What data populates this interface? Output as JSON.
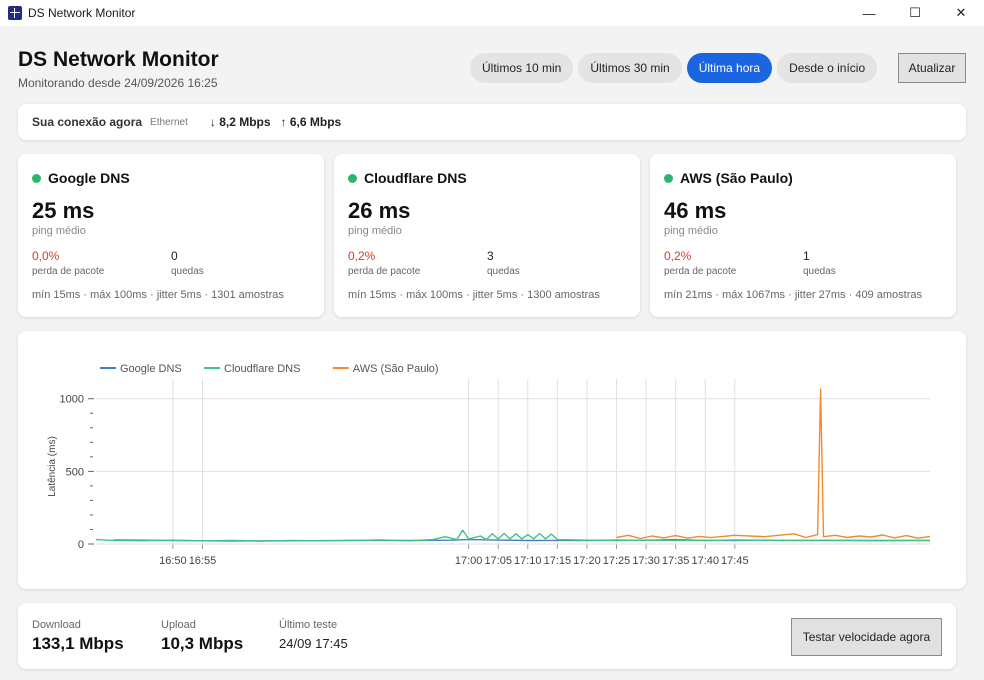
{
  "window": {
    "title": "DS Network Monitor",
    "controls": [
      "—",
      "☐",
      "✕"
    ]
  },
  "header": {
    "title": "DS Network Monitor",
    "subtitle": "Monitorando desde 24/09/2026 16:25",
    "ranges": [
      {
        "label": "Últimos 10 min",
        "active": false
      },
      {
        "label": "Últimos 30 min",
        "active": false
      },
      {
        "label": "Última hora",
        "active": true
      },
      {
        "label": "Desde o início",
        "active": false
      }
    ],
    "refresh_label": "Atualizar"
  },
  "connection": {
    "label": "Sua conexão agora",
    "type": "Ethernet",
    "download": "↓ 8,2 Mbps",
    "upload": "↑ 6,6 Mbps"
  },
  "servers": [
    {
      "name": "Google DNS",
      "ping": "25 ms",
      "ping_label": "ping médio",
      "loss": "0,0%",
      "loss_label": "perda de pacote",
      "drops": "0",
      "drops_label": "quedas",
      "summary": "mín 15ms · máx 100ms · jitter 5ms · 1301 amostras"
    },
    {
      "name": "Cloudflare DNS",
      "ping": "26 ms",
      "ping_label": "ping médio",
      "loss": "0,2%",
      "loss_label": "perda de pacote",
      "drops": "3",
      "drops_label": "quedas",
      "summary": "mín 15ms · máx 100ms · jitter 5ms · 1300 amostras"
    },
    {
      "name": "AWS (São Paulo)",
      "ping": "46 ms",
      "ping_label": "ping médio",
      "loss": "0,2%",
      "loss_label": "perda de pacote",
      "drops": "1",
      "drops_label": "quedas",
      "summary": "mín 21ms · máx 1067ms · jitter 27ms · 409 amostras"
    }
  ],
  "colors": {
    "accent": "#1b66e0",
    "status_ok": "#2db56b",
    "loss_red": "#d23c2e",
    "google": "#4a7fc1",
    "cloudflare": "#3cc48a",
    "aws": "#f08a2c"
  },
  "chart_data": {
    "type": "line",
    "ylabel": "Latência (ms)",
    "xlabel": "",
    "ylim": [
      0,
      1067
    ],
    "yticks": [
      "0",
      "500",
      "1000"
    ],
    "x_domain_min": [
      16.37,
      17.78
    ],
    "xticks": [
      "16:50",
      "16:55",
      "17:00",
      "17:05",
      "17:10",
      "17:15",
      "17:20",
      "17:25",
      "17:30",
      "17:35",
      "17:40",
      "17:45"
    ],
    "legend_position": "top-left",
    "grid": true,
    "series": [
      {
        "name": "Google DNS",
        "color": "#4a7fc1",
        "points": [
          [
            16.4,
            28
          ],
          [
            16.5,
            24
          ],
          [
            16.6,
            20
          ],
          [
            16.7,
            22
          ],
          [
            16.8,
            25
          ],
          [
            16.9,
            24
          ],
          [
            16.97,
            26
          ],
          [
            17.0,
            30
          ],
          [
            17.05,
            27
          ],
          [
            17.1,
            24
          ],
          [
            17.15,
            25
          ],
          [
            17.2,
            24
          ],
          [
            17.25,
            27
          ],
          [
            17.3,
            26
          ],
          [
            17.35,
            30
          ],
          [
            17.4,
            25
          ],
          [
            17.45,
            24
          ],
          [
            17.5,
            26
          ],
          [
            17.55,
            25
          ],
          [
            17.6,
            24
          ],
          [
            17.65,
            25
          ],
          [
            17.7,
            24
          ],
          [
            17.75,
            25
          ],
          [
            17.78,
            24
          ]
        ]
      },
      {
        "name": "Cloudflare DNS",
        "color": "#3cc48a",
        "points": [
          [
            16.37,
            30
          ],
          [
            16.4,
            25
          ],
          [
            16.45,
            22
          ],
          [
            16.5,
            26
          ],
          [
            16.55,
            22
          ],
          [
            16.6,
            24
          ],
          [
            16.65,
            20
          ],
          [
            16.7,
            25
          ],
          [
            16.75,
            22
          ],
          [
            16.8,
            24
          ],
          [
            16.85,
            28
          ],
          [
            16.9,
            22
          ],
          [
            16.94,
            30
          ],
          [
            16.96,
            50
          ],
          [
            16.98,
            30
          ],
          [
            16.99,
            95
          ],
          [
            17.0,
            35
          ],
          [
            17.02,
            55
          ],
          [
            17.03,
            30
          ],
          [
            17.04,
            70
          ],
          [
            17.05,
            35
          ],
          [
            17.06,
            72
          ],
          [
            17.07,
            35
          ],
          [
            17.08,
            70
          ],
          [
            17.09,
            35
          ],
          [
            17.1,
            65
          ],
          [
            17.11,
            35
          ],
          [
            17.12,
            72
          ],
          [
            17.13,
            35
          ],
          [
            17.14,
            68
          ],
          [
            17.15,
            30
          ],
          [
            17.2,
            26
          ],
          [
            17.25,
            24
          ],
          [
            17.3,
            27
          ],
          [
            17.35,
            25
          ],
          [
            17.4,
            24
          ],
          [
            17.45,
            28
          ],
          [
            17.5,
            25
          ],
          [
            17.55,
            24
          ],
          [
            17.6,
            26
          ],
          [
            17.65,
            24
          ],
          [
            17.7,
            22
          ],
          [
            17.75,
            24
          ],
          [
            17.78,
            25
          ]
        ]
      },
      {
        "name": "AWS (São Paulo)",
        "color": "#f08a2c",
        "points": [
          [
            17.25,
            45
          ],
          [
            17.27,
            60
          ],
          [
            17.29,
            38
          ],
          [
            17.31,
            55
          ],
          [
            17.33,
            42
          ],
          [
            17.35,
            58
          ],
          [
            17.37,
            40
          ],
          [
            17.39,
            52
          ],
          [
            17.41,
            44
          ],
          [
            17.45,
            60
          ],
          [
            17.5,
            50
          ],
          [
            17.55,
            70
          ],
          [
            17.57,
            45
          ],
          [
            17.59,
            65
          ],
          [
            17.595,
            1067
          ],
          [
            17.6,
            50
          ],
          [
            17.62,
            60
          ],
          [
            17.64,
            45
          ],
          [
            17.66,
            55
          ],
          [
            17.68,
            48
          ],
          [
            17.7,
            62
          ],
          [
            17.72,
            42
          ],
          [
            17.74,
            58
          ],
          [
            17.76,
            40
          ],
          [
            17.78,
            52
          ]
        ]
      }
    ]
  },
  "speedtest": {
    "download_label": "Download",
    "download": "133,1 Mbps",
    "upload_label": "Upload",
    "upload": "10,3 Mbps",
    "last_label": "Último teste",
    "last": "24/09 17:45",
    "button": "Testar velocidade agora"
  }
}
